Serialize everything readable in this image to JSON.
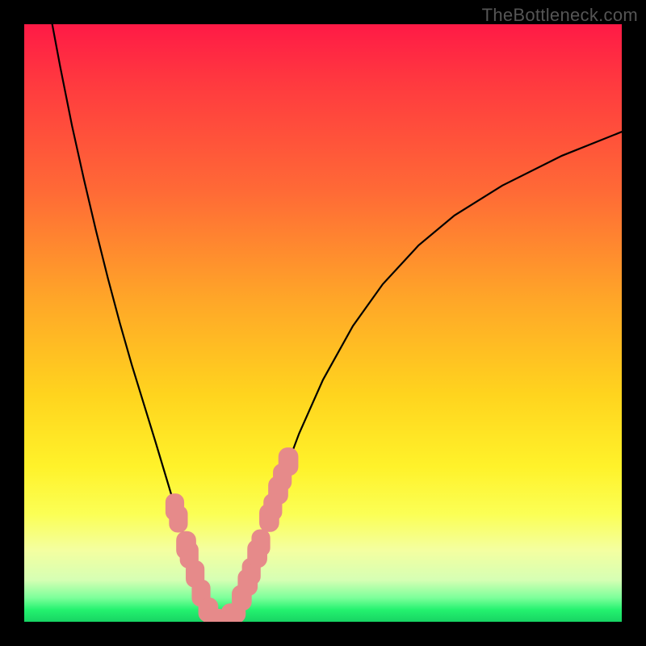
{
  "watermark": "TheBottleneck.com",
  "chart_data": {
    "type": "line",
    "title": "",
    "xlabel": "",
    "ylabel": "",
    "xlim": [
      0,
      100
    ],
    "ylim": [
      0,
      100
    ],
    "gradient_stops": [
      {
        "pos": 0,
        "color": "#ff1a46"
      },
      {
        "pos": 10,
        "color": "#ff3a3f"
      },
      {
        "pos": 28,
        "color": "#ff6a36"
      },
      {
        "pos": 46,
        "color": "#ffa628"
      },
      {
        "pos": 62,
        "color": "#ffd41e"
      },
      {
        "pos": 74,
        "color": "#fff22a"
      },
      {
        "pos": 82,
        "color": "#fbff55"
      },
      {
        "pos": 88,
        "color": "#f4ffa0"
      },
      {
        "pos": 93,
        "color": "#d6ffb4"
      },
      {
        "pos": 96,
        "color": "#7cff9a"
      },
      {
        "pos": 98,
        "color": "#24f26f"
      },
      {
        "pos": 100,
        "color": "#17d463"
      }
    ],
    "curve_points": [
      {
        "x": 4.5,
        "y": 101.0
      },
      {
        "x": 6.0,
        "y": 93.0
      },
      {
        "x": 8.0,
        "y": 83.0
      },
      {
        "x": 10.0,
        "y": 74.0
      },
      {
        "x": 12.0,
        "y": 65.5
      },
      {
        "x": 14.0,
        "y": 57.5
      },
      {
        "x": 16.0,
        "y": 50.0
      },
      {
        "x": 18.0,
        "y": 43.0
      },
      {
        "x": 20.0,
        "y": 36.5
      },
      {
        "x": 22.0,
        "y": 30.0
      },
      {
        "x": 23.5,
        "y": 25.0
      },
      {
        "x": 25.0,
        "y": 20.0
      },
      {
        "x": 26.5,
        "y": 15.0
      },
      {
        "x": 28.0,
        "y": 10.0
      },
      {
        "x": 29.0,
        "y": 6.5
      },
      {
        "x": 30.0,
        "y": 3.5
      },
      {
        "x": 31.0,
        "y": 1.5
      },
      {
        "x": 32.0,
        "y": 0.4
      },
      {
        "x": 33.0,
        "y": 0.0
      },
      {
        "x": 34.0,
        "y": 0.4
      },
      {
        "x": 35.0,
        "y": 1.5
      },
      {
        "x": 36.0,
        "y": 3.3
      },
      {
        "x": 37.5,
        "y": 7.0
      },
      {
        "x": 39.0,
        "y": 11.5
      },
      {
        "x": 41.0,
        "y": 17.5
      },
      {
        "x": 43.0,
        "y": 23.5
      },
      {
        "x": 46.0,
        "y": 31.5
      },
      {
        "x": 50.0,
        "y": 40.5
      },
      {
        "x": 55.0,
        "y": 49.5
      },
      {
        "x": 60.0,
        "y": 56.5
      },
      {
        "x": 66.0,
        "y": 63.0
      },
      {
        "x": 72.0,
        "y": 68.0
      },
      {
        "x": 80.0,
        "y": 73.0
      },
      {
        "x": 90.0,
        "y": 78.0
      },
      {
        "x": 100.0,
        "y": 82.0
      }
    ],
    "markers": [
      {
        "x": 25.2,
        "y": 19.2,
        "rx": 1.5,
        "ry": 2.2
      },
      {
        "x": 25.8,
        "y": 17.2,
        "rx": 1.5,
        "ry": 2.2
      },
      {
        "x": 27.1,
        "y": 12.8,
        "rx": 1.6,
        "ry": 2.3
      },
      {
        "x": 27.6,
        "y": 11.2,
        "rx": 1.5,
        "ry": 2.2
      },
      {
        "x": 28.6,
        "y": 8.0,
        "rx": 1.5,
        "ry": 2.2
      },
      {
        "x": 29.6,
        "y": 4.8,
        "rx": 1.5,
        "ry": 2.2
      },
      {
        "x": 30.8,
        "y": 2.0,
        "rx": 1.6,
        "ry": 2.0
      },
      {
        "x": 32.0,
        "y": 0.6,
        "rx": 2.0,
        "ry": 1.5
      },
      {
        "x": 33.5,
        "y": 0.3,
        "rx": 2.0,
        "ry": 1.5
      },
      {
        "x": 35.0,
        "y": 1.4,
        "rx": 2.0,
        "ry": 1.6
      },
      {
        "x": 36.4,
        "y": 4.0,
        "rx": 1.6,
        "ry": 2.1
      },
      {
        "x": 37.4,
        "y": 6.6,
        "rx": 1.6,
        "ry": 2.2
      },
      {
        "x": 38.0,
        "y": 8.4,
        "rx": 1.5,
        "ry": 2.2
      },
      {
        "x": 39.0,
        "y": 11.4,
        "rx": 1.6,
        "ry": 2.3
      },
      {
        "x": 39.6,
        "y": 13.2,
        "rx": 1.5,
        "ry": 2.2
      },
      {
        "x": 41.0,
        "y": 17.4,
        "rx": 1.6,
        "ry": 2.3
      },
      {
        "x": 41.6,
        "y": 19.2,
        "rx": 1.5,
        "ry": 2.2
      },
      {
        "x": 42.5,
        "y": 22.0,
        "rx": 1.6,
        "ry": 2.3
      },
      {
        "x": 43.2,
        "y": 24.2,
        "rx": 1.5,
        "ry": 2.2
      },
      {
        "x": 44.2,
        "y": 26.8,
        "rx": 1.6,
        "ry": 2.3
      }
    ],
    "marker_color": "#e68a8a",
    "minimum_x": 33.0
  }
}
